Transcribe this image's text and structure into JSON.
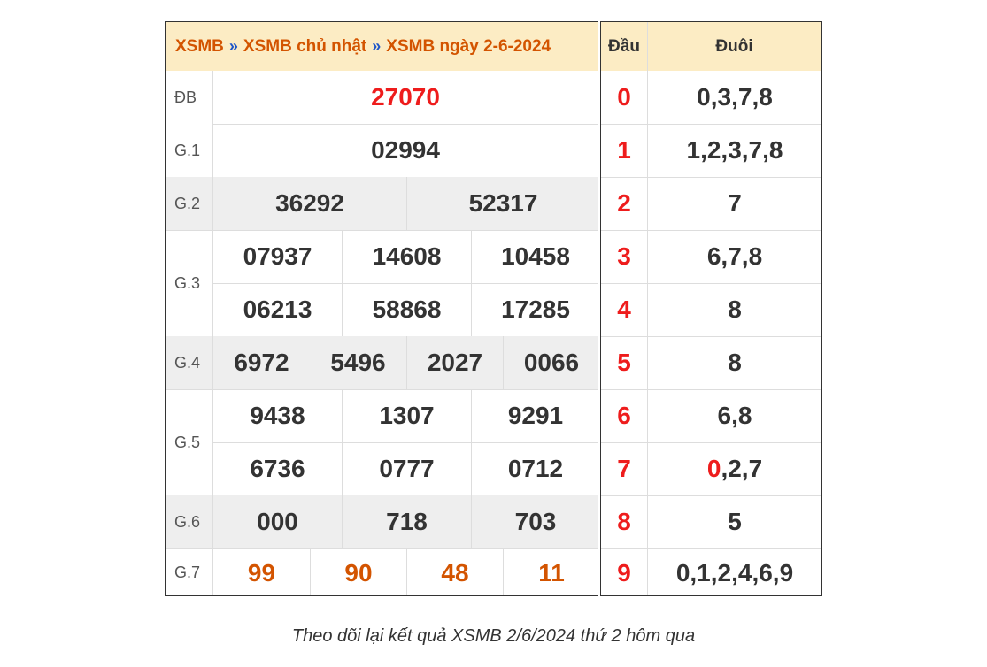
{
  "header": {
    "crumb1": "XSMB",
    "crumb2": "XSMB chủ nhật",
    "crumb3": "XSMB ngày 2-6-2024",
    "separator": "»"
  },
  "prizes": {
    "db": {
      "label": "ĐB",
      "numbers": [
        "27070"
      ]
    },
    "g1": {
      "label": "G.1",
      "numbers": [
        "02994"
      ]
    },
    "g2": {
      "label": "G.2",
      "numbers": [
        "36292",
        "52317"
      ]
    },
    "g3": {
      "label": "G.3",
      "numbers": [
        "07937",
        "14608",
        "10458",
        "06213",
        "58868",
        "17285"
      ]
    },
    "g4": {
      "label": "G.4",
      "numbers": [
        "6972",
        "5496",
        "2027",
        "0066"
      ]
    },
    "g5": {
      "label": "G.5",
      "numbers": [
        "9438",
        "1307",
        "9291",
        "6736",
        "0777",
        "0712"
      ]
    },
    "g6": {
      "label": "G.6",
      "numbers": [
        "000",
        "718",
        "703"
      ]
    },
    "g7": {
      "label": "G.7",
      "numbers": [
        "99",
        "90",
        "48",
        "11"
      ]
    }
  },
  "loto": {
    "head_label": "Đầu",
    "tail_label": "Đuôi",
    "rows": [
      {
        "dau": "0",
        "duoi": "0,3,7,8"
      },
      {
        "dau": "1",
        "duoi": "1,2,3,7,8"
      },
      {
        "dau": "2",
        "duoi": "7"
      },
      {
        "dau": "3",
        "duoi": "6,7,8"
      },
      {
        "dau": "4",
        "duoi": "8"
      },
      {
        "dau": "5",
        "duoi": "8"
      },
      {
        "dau": "6",
        "duoi": "6,8"
      },
      {
        "dau": "7",
        "duoi_highlight": "0",
        "duoi_rest": ",2,7"
      },
      {
        "dau": "8",
        "duoi": "5"
      },
      {
        "dau": "9",
        "duoi": "0,1,2,4,6,9"
      }
    ]
  },
  "caption": "Theo dõi lại kết quả XSMB 2/6/2024 thứ 2 hôm qua",
  "colors": {
    "header_bg": "#fcecc4",
    "header_text": "#d35400",
    "separator": "#1e56c8",
    "special_prize": "#ee1c1c",
    "g7_prize": "#d35400",
    "dau_digit": "#ee1c1c",
    "shaded_row": "#eeeeee"
  }
}
